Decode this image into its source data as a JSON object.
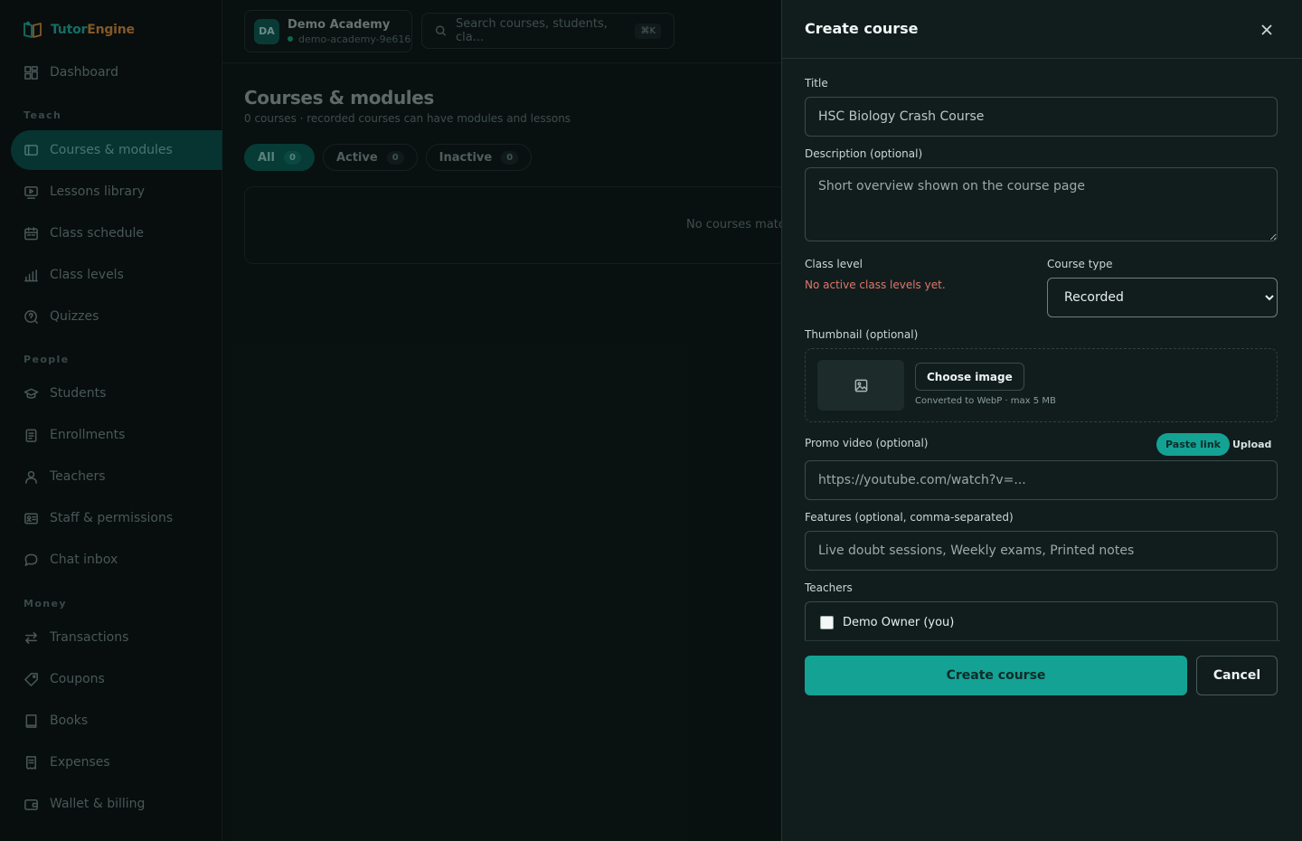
{
  "brand": {
    "name_part1": "Tutor",
    "name_part2": "Engine"
  },
  "sidebar": {
    "items": [
      {
        "label": "Dashboard"
      },
      {
        "label": "Courses & modules"
      },
      {
        "label": "Lessons library"
      },
      {
        "label": "Class schedule"
      },
      {
        "label": "Class levels"
      },
      {
        "label": "Quizzes"
      },
      {
        "label": "Students"
      },
      {
        "label": "Enrollments"
      },
      {
        "label": "Teachers"
      },
      {
        "label": "Staff & permissions"
      },
      {
        "label": "Chat inbox"
      },
      {
        "label": "Transactions"
      },
      {
        "label": "Coupons"
      },
      {
        "label": "Books"
      },
      {
        "label": "Expenses"
      },
      {
        "label": "Wallet & billing"
      }
    ],
    "sections": {
      "teach": "Teach",
      "people": "People",
      "money": "Money"
    },
    "active": "Courses & modules"
  },
  "workspace": {
    "initials": "DA",
    "name": "Demo Academy",
    "slug": "demo-academy-9e616"
  },
  "search": {
    "placeholder": "Search courses, students, cla...",
    "shortcut": "⌘K"
  },
  "main": {
    "title": "Courses & modules",
    "subtitle": "0 courses · recorded courses can have modules and lessons",
    "filters": [
      {
        "label": "All",
        "count": "0",
        "active": true
      },
      {
        "label": "Active",
        "count": "0"
      },
      {
        "label": "Inactive",
        "count": "0"
      }
    ],
    "empty_text": "No courses match"
  },
  "drawer": {
    "title": "Create course",
    "title_label": "Title",
    "title_value": "HSC Biology Crash Course",
    "description_label": "Description (optional)",
    "description_placeholder": "Short overview shown on the course page",
    "class_level_label": "Class level",
    "class_level_error": "No active class levels yet.",
    "course_type_label": "Course type",
    "course_type_value": "Recorded",
    "thumbnail_label": "Thumbnail (optional)",
    "choose_image": "Choose image",
    "thumbnail_hint": "Converted to WebP · max 5 MB",
    "promo_label": "Promo video (optional)",
    "promo_tabs": {
      "paste": "Paste link",
      "upload": "Upload"
    },
    "promo_placeholder": "https://youtube.com/watch?v=...",
    "features_label": "Features (optional, comma-separated)",
    "features_placeholder": "Live doubt sessions, Weekly exams, Printed notes",
    "teachers_label": "Teachers",
    "teacher_option": "Demo Owner (you)",
    "submit": "Create course",
    "cancel": "Cancel"
  },
  "colors": {
    "accent": "#14a294",
    "error": "#e0766b",
    "brand_teal": "#1fa89b",
    "brand_orange": "#c9883c"
  }
}
